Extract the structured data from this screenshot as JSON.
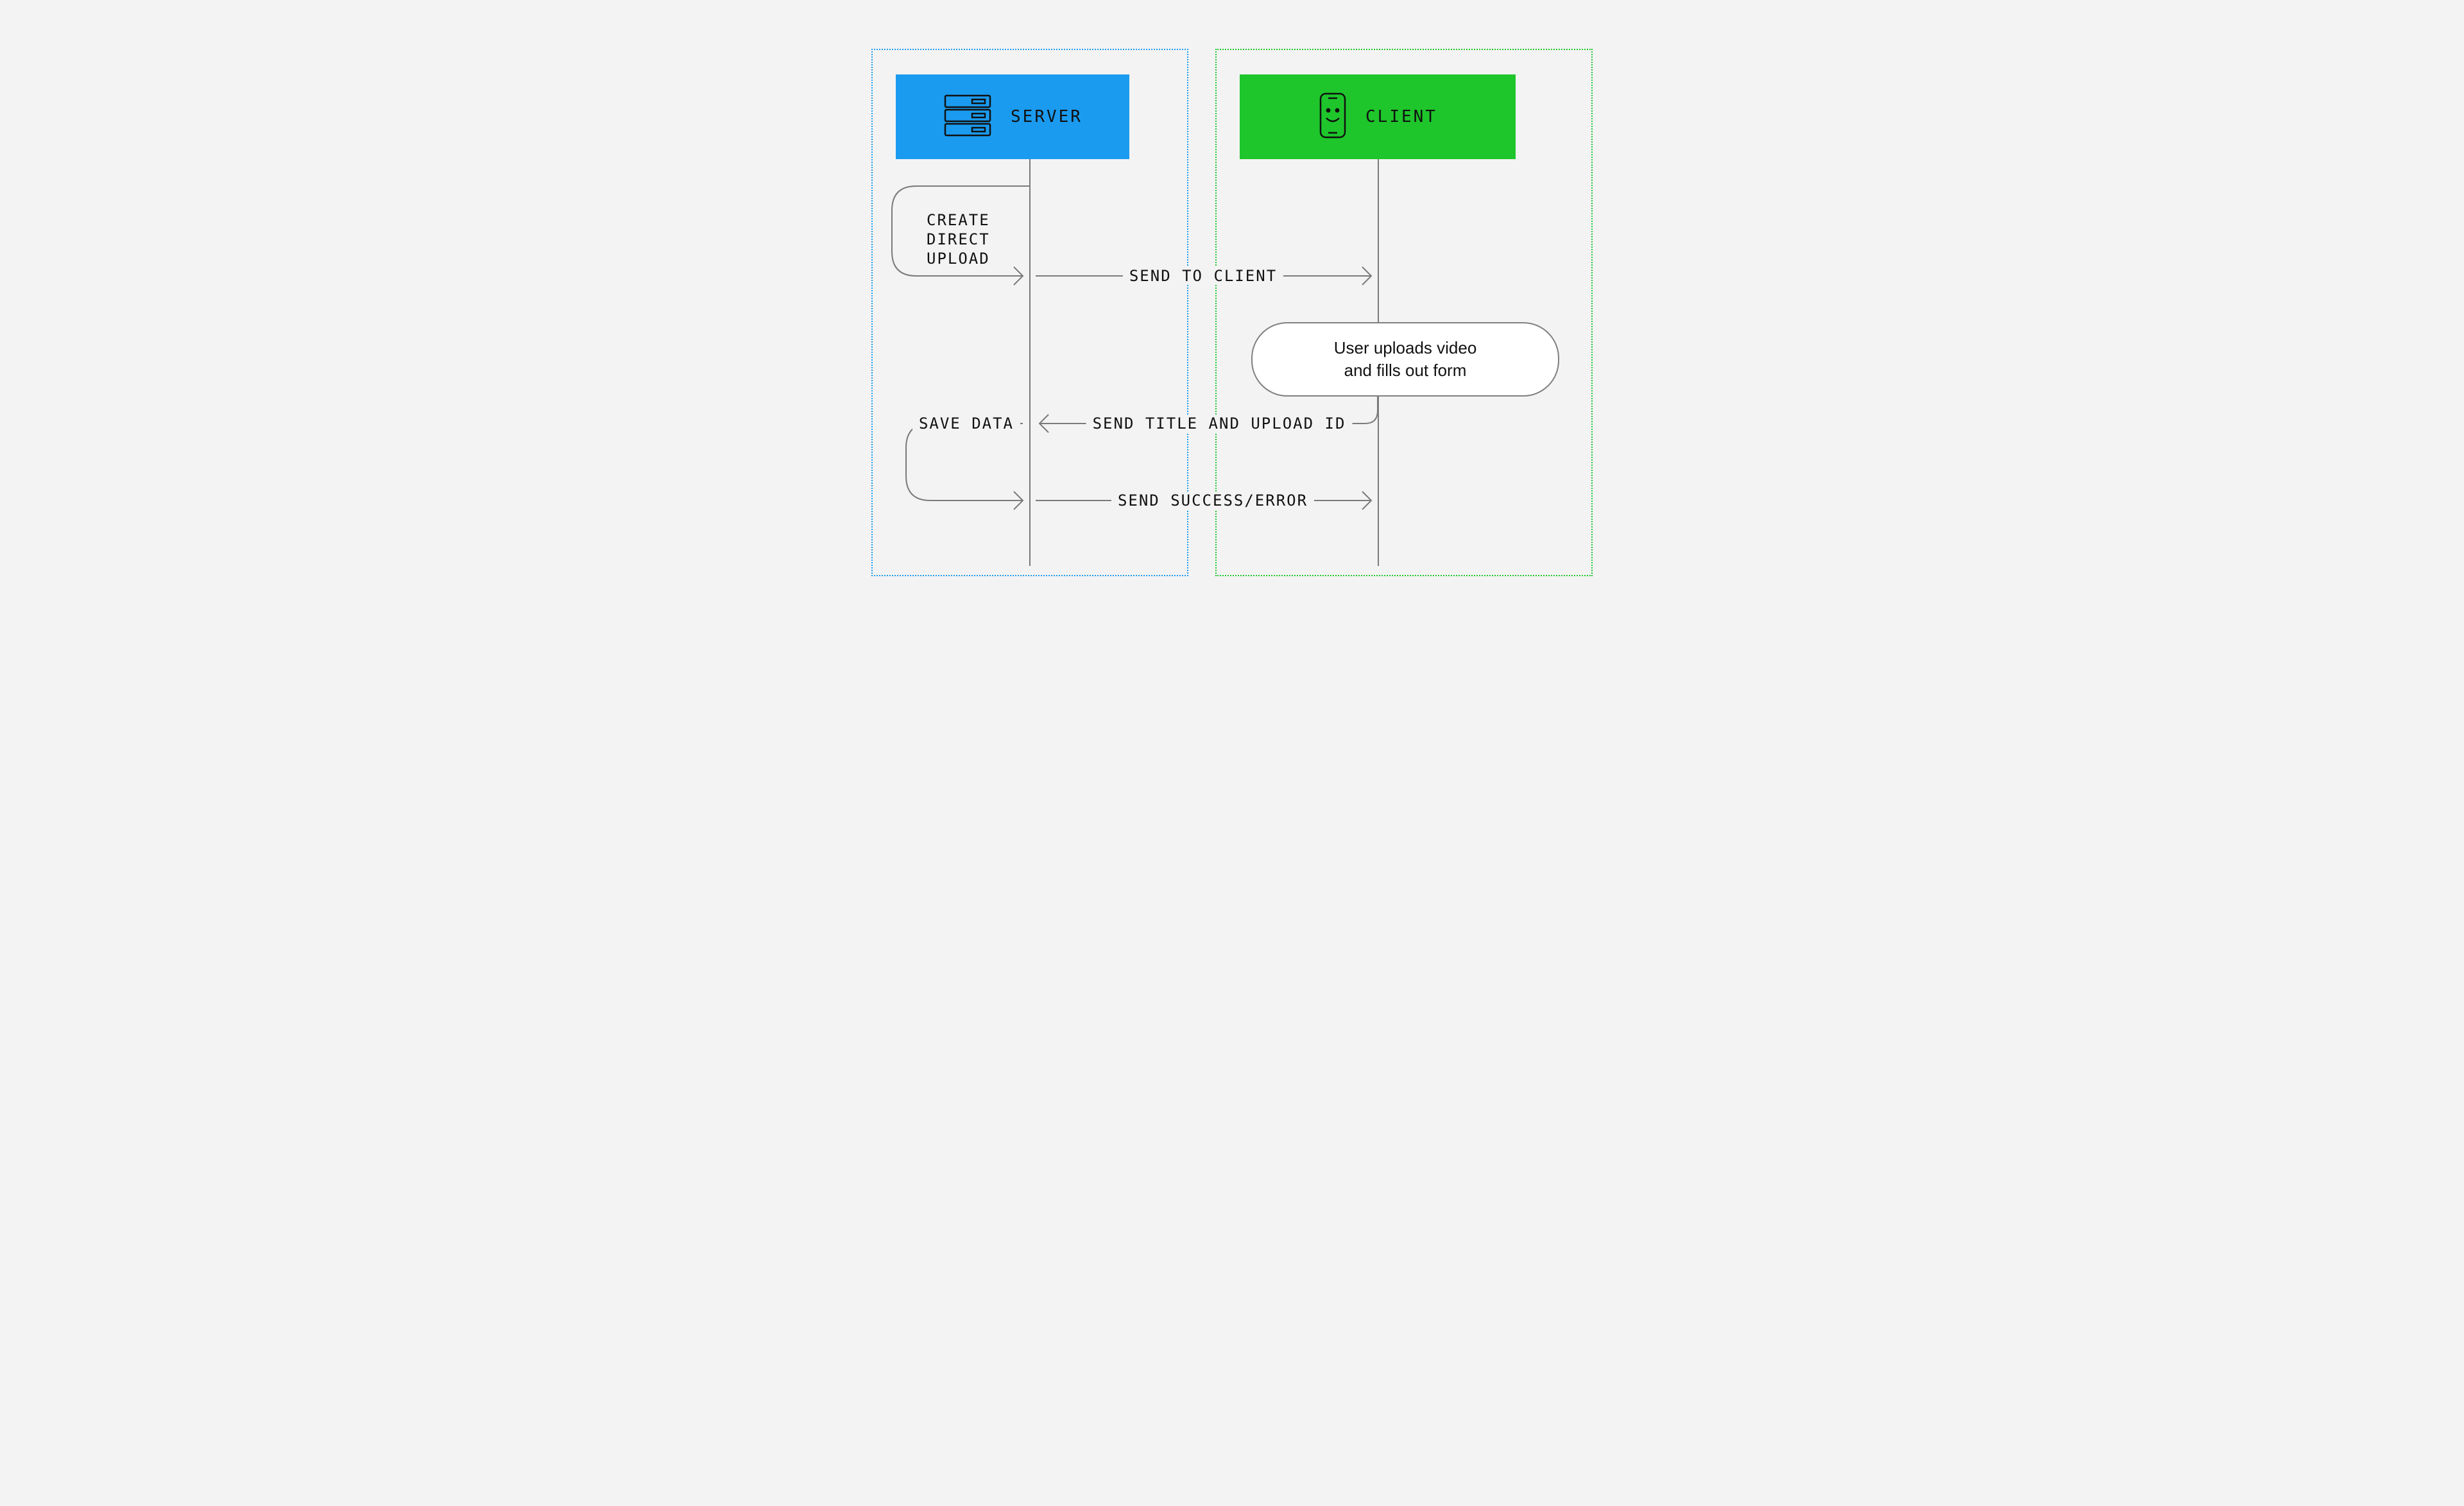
{
  "participants": {
    "server": {
      "label": "SERVER"
    },
    "client": {
      "label": "CLIENT"
    }
  },
  "messages": {
    "create_direct_upload": "CREATE\nDIRECT\nUPLOAD",
    "send_to_client": "SEND TO CLIENT",
    "user_uploads_note": "User uploads video\nand fills out form",
    "send_title_upload_id": "SEND TITLE AND UPLOAD ID",
    "save_data": "SAVE DATA",
    "send_success_error": "SEND SUCCESS/ERROR"
  },
  "colors": {
    "server": "#1a9bf0",
    "client": "#1ec62b",
    "arrow": "#7a7a7a",
    "bg": "#f3f3f3"
  }
}
